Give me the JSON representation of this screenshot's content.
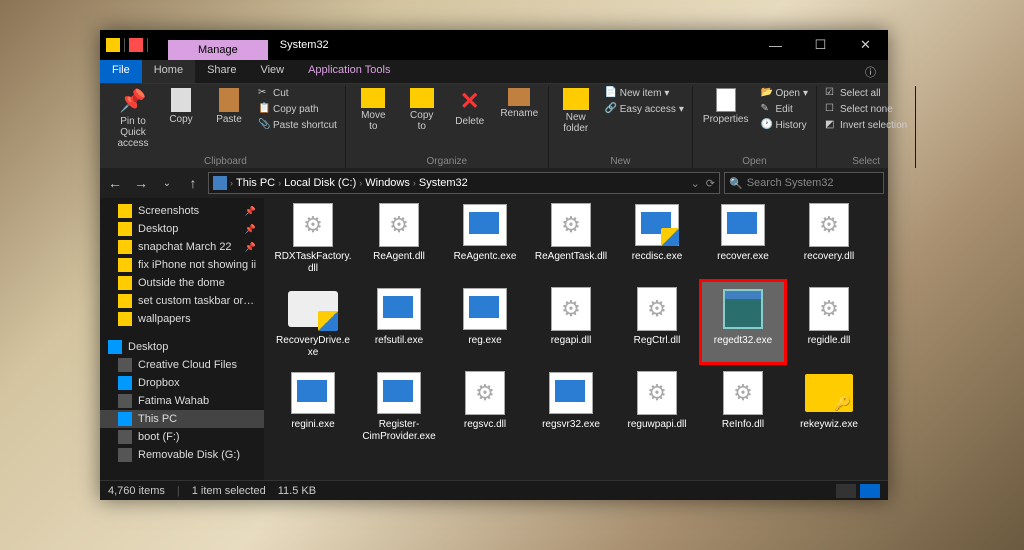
{
  "title_tab": "Manage",
  "window_title": "System32",
  "menu": {
    "file": "File",
    "home": "Home",
    "share": "Share",
    "view": "View",
    "tools": "Application Tools"
  },
  "ribbon": {
    "clipboard": {
      "label": "Clipboard",
      "pin": "Pin to Quick access",
      "copy": "Copy",
      "paste": "Paste",
      "cut": "Cut",
      "copypath": "Copy path",
      "pasteshort": "Paste shortcut"
    },
    "organize": {
      "label": "Organize",
      "moveto": "Move to",
      "copyto": "Copy to",
      "delete": "Delete",
      "rename": "Rename"
    },
    "new": {
      "label": "New",
      "newfolder": "New folder",
      "newitem": "New item",
      "easyaccess": "Easy access"
    },
    "open": {
      "label": "Open",
      "properties": "Properties",
      "open": "Open",
      "edit": "Edit",
      "history": "History"
    },
    "select": {
      "label": "Select",
      "all": "Select all",
      "none": "Select none",
      "invert": "Invert selection"
    }
  },
  "breadcrumb": [
    "This PC",
    "Local Disk (C:)",
    "Windows",
    "System32"
  ],
  "search_placeholder": "Search System32",
  "sidebar": {
    "quick": [
      {
        "label": "Screenshots",
        "icon": "folder-ic",
        "pin": true
      },
      {
        "label": "Desktop",
        "icon": "folder-ic",
        "pin": true
      },
      {
        "label": "snapchat March 22",
        "icon": "folder-ic",
        "pin": true
      },
      {
        "label": "fix iPhone not showing ii",
        "icon": "folder-ic",
        "pin": false
      },
      {
        "label": "Outside the dome",
        "icon": "folder-ic",
        "pin": false
      },
      {
        "label": "set custom taskbar orien",
        "icon": "folder-ic",
        "pin": false
      },
      {
        "label": "wallpapers",
        "icon": "folder-ic",
        "pin": false
      }
    ],
    "desktop": {
      "label": "Desktop"
    },
    "tree": [
      {
        "label": "Creative Cloud Files",
        "icon": "dark-ic"
      },
      {
        "label": "Dropbox",
        "icon": "blue-ic"
      },
      {
        "label": "Fatima Wahab",
        "icon": "dark-ic"
      },
      {
        "label": "This PC",
        "icon": "blue-ic",
        "sel": true
      },
      {
        "label": "boot (F:)",
        "icon": "dark-ic"
      },
      {
        "label": "Removable Disk (G:)",
        "icon": "dark-ic"
      }
    ]
  },
  "files": [
    {
      "name": "RDXTaskFactory.dll",
      "type": "dll"
    },
    {
      "name": "ReAgent.dll",
      "type": "dll"
    },
    {
      "name": "ReAgentc.exe",
      "type": "exe"
    },
    {
      "name": "ReAgentTask.dll",
      "type": "dll"
    },
    {
      "name": "recdisc.exe",
      "type": "shield"
    },
    {
      "name": "recover.exe",
      "type": "exe"
    },
    {
      "name": "recovery.dll",
      "type": "dll"
    },
    {
      "name": "RecoveryDrive.exe",
      "type": "recdrive"
    },
    {
      "name": "refsutil.exe",
      "type": "exe"
    },
    {
      "name": "reg.exe",
      "type": "exe"
    },
    {
      "name": "regapi.dll",
      "type": "dll"
    },
    {
      "name": "RegCtrl.dll",
      "type": "dll"
    },
    {
      "name": "regedt32.exe",
      "type": "regedt",
      "selected": true,
      "highlight": true
    },
    {
      "name": "regidle.dll",
      "type": "dll"
    },
    {
      "name": "regini.exe",
      "type": "exe"
    },
    {
      "name": "Register-CimProvider.exe",
      "type": "exe"
    },
    {
      "name": "regsvc.dll",
      "type": "dll"
    },
    {
      "name": "regsvr32.exe",
      "type": "exe"
    },
    {
      "name": "reguwpapi.dll",
      "type": "dll"
    },
    {
      "name": "ReInfo.dll",
      "type": "dll"
    },
    {
      "name": "rekeywiz.exe",
      "type": "folderkey"
    }
  ],
  "status": {
    "items": "4,760 items",
    "selected": "1 item selected",
    "size": "11.5 KB"
  }
}
